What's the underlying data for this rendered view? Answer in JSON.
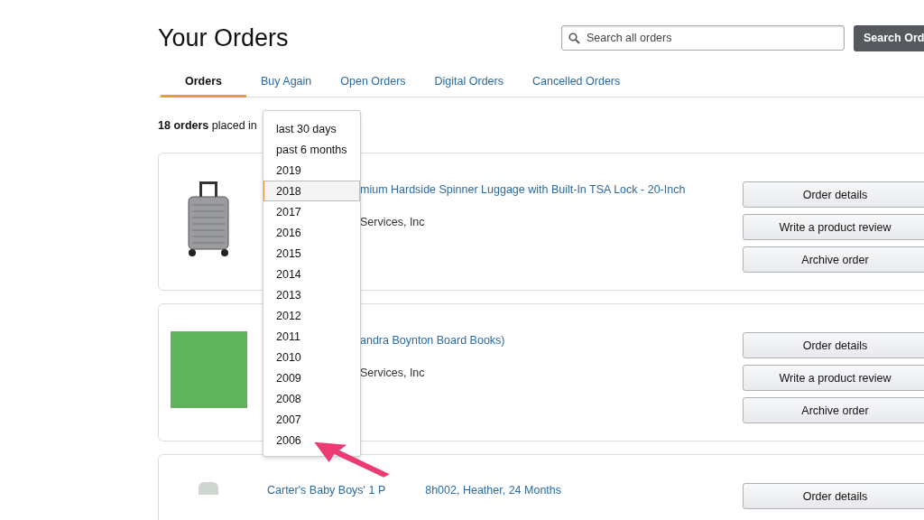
{
  "page_title": "Your Orders",
  "search": {
    "placeholder": "Search all orders",
    "button": "Search Ord"
  },
  "tabs": [
    {
      "label": "Orders",
      "selected": true
    },
    {
      "label": "Buy Again",
      "selected": false
    },
    {
      "label": "Open Orders",
      "selected": false
    },
    {
      "label": "Digital Orders",
      "selected": false
    },
    {
      "label": "Cancelled Orders",
      "selected": false
    }
  ],
  "summary": {
    "count": "18 orders",
    "text": "placed in"
  },
  "period_dropdown": {
    "options": [
      {
        "label": "last 30 days",
        "selected": false
      },
      {
        "label": "past 6 months",
        "selected": false
      },
      {
        "label": "2019",
        "selected": false
      },
      {
        "label": "2018",
        "selected": true
      },
      {
        "label": "2017",
        "selected": false
      },
      {
        "label": "2016",
        "selected": false
      },
      {
        "label": "2015",
        "selected": false
      },
      {
        "label": "2014",
        "selected": false
      },
      {
        "label": "2013",
        "selected": false
      },
      {
        "label": "2012",
        "selected": false
      },
      {
        "label": "2011",
        "selected": false
      },
      {
        "label": "2010",
        "selected": false
      },
      {
        "label": "2009",
        "selected": false
      },
      {
        "label": "2008",
        "selected": false
      },
      {
        "label": "2007",
        "selected": false
      },
      {
        "label": "2006",
        "selected": false
      }
    ]
  },
  "orders": [
    {
      "kind": "luggage",
      "title": "mium Hardside Spinner Luggage with Built-In TSA Lock - 20-Inch",
      "seller": "Services, Inc",
      "buttons": [
        "Order details",
        "Write a product review",
        "Archive order"
      ]
    },
    {
      "kind": "book",
      "title": "andra Boynton Board Books)",
      "seller": "Services, Inc",
      "buttons": [
        "Order details",
        "Write a product review",
        "Archive order"
      ]
    },
    {
      "kind": "clothing",
      "title_parts": [
        "Carter's Baby Boys' 1 P",
        "8h002, Heather, 24 Months"
      ],
      "buttons": [
        "Order details"
      ]
    }
  ]
}
